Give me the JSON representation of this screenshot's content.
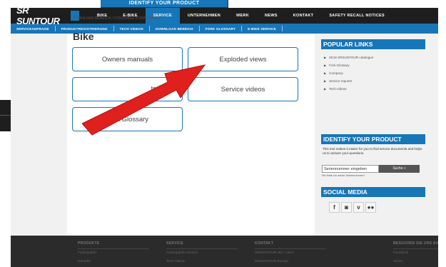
{
  "floating_strip": {
    "label": "IDENTIFY YOUR PRODUCT"
  },
  "brand": {
    "logo_text": "SR SUNTOUR"
  },
  "nav": {
    "items": [
      "BIKE",
      "E-BIKE",
      "SERVICE",
      "UNTERNEHMEN",
      "WERK",
      "NEWS",
      "KONTAKT",
      "SAFETY RECALL NOTICES"
    ],
    "active": "SERVICE"
  },
  "subnav": {
    "items": [
      "SERVICEANFRAGE",
      "PRODUKTREGISTRIERUNG",
      "TECH VIDEOS",
      "DOWNLOAD BEREICH",
      "FORK GLOSSARY",
      "E-BIKE SERVICE"
    ]
  },
  "breadcrumb": {
    "part1": "DOWNLOAD BEREICH",
    "sep": "/",
    "part2": "CONSUMER DOWNLOADS",
    "current": "BIKE"
  },
  "page": {
    "title": "Bike"
  },
  "tiles": {
    "owners_manuals": "Owners manuals",
    "exploded_views": "Exploded views",
    "obscured_partial": "ts",
    "service_videos": "Service videos",
    "fork_glossary": "Fork Glossary"
  },
  "sidebar": {
    "popular_links_title": "POPULAR LINKS",
    "links": [
      "2K18 SRSUNTOUR catalogue",
      "Fork Glossary",
      "Company",
      "Service request",
      "Tech-videos"
    ],
    "identify_title": "IDENTIFY YOUR PRODUCT",
    "identify_text": "This tool makes it easier for you to find service documents and helps us to answer your questions.",
    "serial_input_value": "Seriennummer eingeben",
    "serial_button": "Suche »",
    "serial_hint": "Wo finde ich meine Seriennummer?",
    "social_title": "SOCIAL MEDIA",
    "social_icons": [
      "f",
      "◙",
      "v",
      "●●"
    ]
  },
  "footer": {
    "columns": [
      {
        "head": "PRODUKTE",
        "items": [
          "Federgabeln",
          "Dämpfer"
        ]
      },
      {
        "head": "SERVICE",
        "items": [
          "Federgabeln Service",
          "Tech Videos"
        ]
      },
      {
        "head": "KONTAKT",
        "items": [
          "SRSUNTOUR HQ / Asien",
          "SRSUNTOUR Europa"
        ]
      },
      {
        "head": "BESUCHEN SIE UNS AUCH",
        "items": [
          "Facebook",
          "Vimeo"
        ]
      }
    ]
  },
  "colors": {
    "brand_blue": "#1676b8",
    "nav_dark": "#1e1e1e",
    "arrow_red": "#e0201c"
  }
}
